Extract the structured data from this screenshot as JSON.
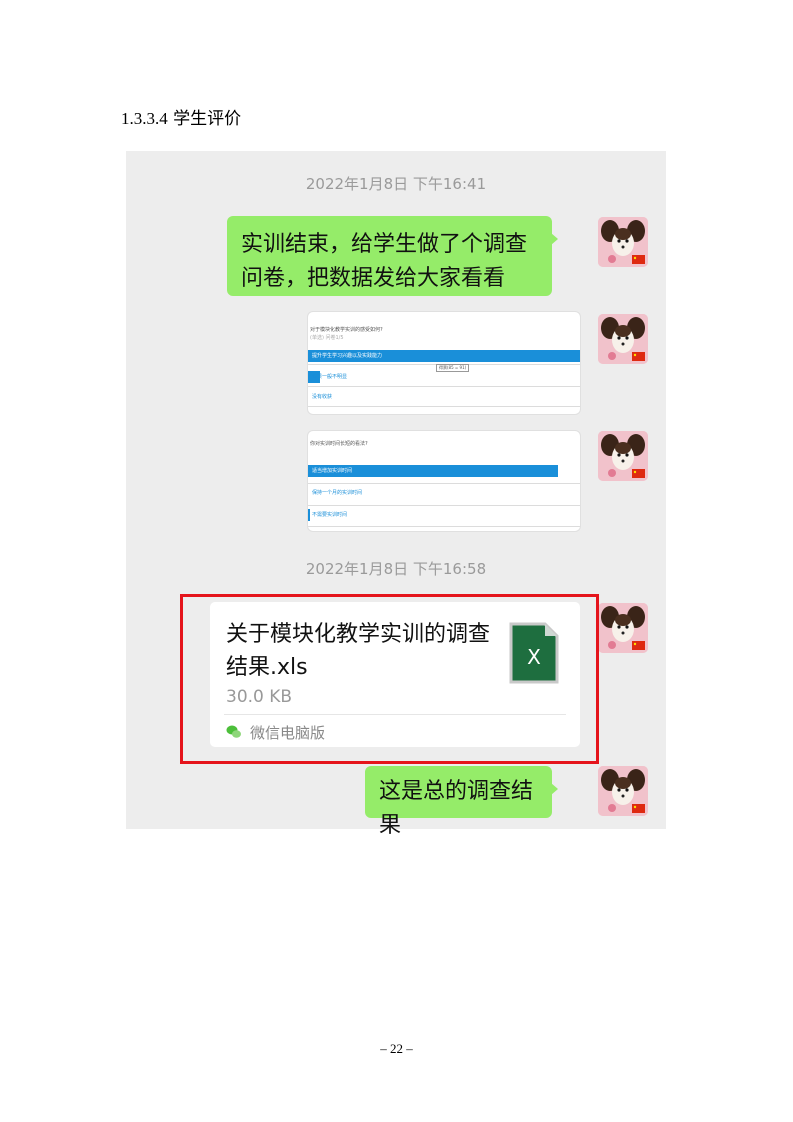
{
  "heading": {
    "number": "1.3.3.4",
    "title": "学生评价"
  },
  "chat": {
    "timestamp_1": "2022年1月8日 下午16:41",
    "message_1": "实训结束，给学生做了个调查问卷，把数据发给大家看看",
    "screenshot_1": {
      "question": "对于模块化教学实训的感受如何?",
      "sub": "(单选) 问卷1/5",
      "options": [
        "提升学生学习兴趣以及实践能力",
        "效果一般不明显",
        "没有收获"
      ],
      "tag": "得票(85 = 91)"
    },
    "screenshot_2": {
      "question": "你对实训时间长短的看法?",
      "options": [
        "适当增加实训时间",
        "保持一个月的实训时间",
        "不需要实训时间"
      ]
    },
    "timestamp_2": "2022年1月8日 下午16:58",
    "file": {
      "name": "关于模块化教学实训的调查结果.xls",
      "size": "30.0 KB",
      "source": "微信电脑版",
      "icon": "excel-file-icon"
    },
    "message_2": "这是总的调查结果"
  },
  "page_number": "– 22 –",
  "colors": {
    "bubble": "#95ec69",
    "chat_bg": "#ededed",
    "highlight": "#e5141c",
    "excel": "#1e6e3f"
  }
}
